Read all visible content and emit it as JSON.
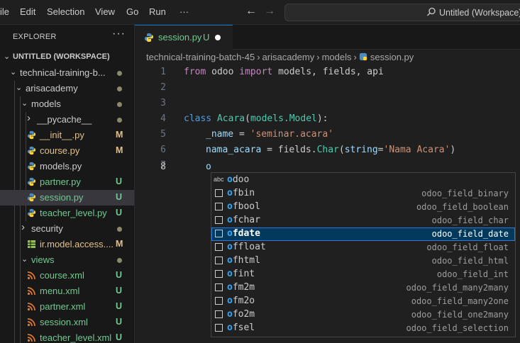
{
  "menu": [
    "ile",
    "Edit",
    "Selection",
    "View",
    "Go",
    "Run",
    "···"
  ],
  "title_bar": {
    "search_text": "Untitled (Workspace)"
  },
  "sidebar": {
    "title": "EXPLORER",
    "more": "···",
    "workspace": "UNTITLED (WORKSPACE)",
    "items": [
      {
        "label": "technical-training-b...",
        "color": "#cccccc",
        "status": "dot"
      },
      {
        "label": "arisacademy",
        "color": "#cccccc",
        "status": "dot"
      },
      {
        "label": "models",
        "color": "#cccccc",
        "status": "dot"
      },
      {
        "label": "__pycache__",
        "color": "#cccccc",
        "status": "dot"
      },
      {
        "label": "__init__.py",
        "color": "#e2c08d",
        "status": "M"
      },
      {
        "label": "course.py",
        "color": "#e2c08d",
        "status": "M"
      },
      {
        "label": "models.py",
        "color": "#cccccc",
        "status": ""
      },
      {
        "label": "partner.py",
        "color": "#73c991",
        "status": "U"
      },
      {
        "label": "session.py",
        "color": "#73c991",
        "status": "U"
      },
      {
        "label": "teacher_level.py",
        "color": "#73c991",
        "status": "U"
      },
      {
        "label": "security",
        "color": "#cccccc",
        "status": "dot"
      },
      {
        "label": "ir.model.access....",
        "color": "#e2c08d",
        "status": "M"
      },
      {
        "label": "views",
        "color": "#73c991",
        "status": "dot"
      },
      {
        "label": "course.xml",
        "color": "#73c991",
        "status": "U"
      },
      {
        "label": "menu.xml",
        "color": "#73c991",
        "status": "U"
      },
      {
        "label": "partner.xml",
        "color": "#73c991",
        "status": "U"
      },
      {
        "label": "session.xml",
        "color": "#73c991",
        "status": "U"
      },
      {
        "label": "teacher_level.xml",
        "color": "#73c991",
        "status": "U"
      }
    ]
  },
  "tab": {
    "name": "session.py",
    "status": "U"
  },
  "breadcrumb": [
    "technical-training-batch-45",
    "arisacademy",
    "models",
    "session.py"
  ],
  "code": {
    "line_numbers": [
      "1",
      "2",
      "3",
      "4",
      "5",
      "6",
      "7",
      "8"
    ],
    "l1": {
      "from": "from",
      "mod": " odoo ",
      "import": "import",
      "rest": " models, fields, api"
    },
    "l4": {
      "class": "class",
      "name": "Acara",
      "base": "models.Model",
      "colon": "):"
    },
    "l5": {
      "var": "_name",
      "eq": " = ",
      "val": "'seminar.acara'"
    },
    "l7": {
      "var": "nama_acara",
      "eq": " = fields.",
      "fn": "Char",
      "open": "(",
      "kw": "string",
      "eq2": "=",
      "val": "'Nama Acara'",
      "close": ")"
    },
    "l8": {
      "typed": "o"
    }
  },
  "suggestions": [
    {
      "kind": "abc",
      "match": "o",
      "rest": "doo",
      "detail": ""
    },
    {
      "kind": "snippet",
      "match": "o",
      "rest": "fbin",
      "detail": "odoo_field_binary"
    },
    {
      "kind": "snippet",
      "match": "o",
      "rest": "fbool",
      "detail": "odoo_field_boolean"
    },
    {
      "kind": "snippet",
      "match": "o",
      "rest": "fchar",
      "detail": "odoo_field_char"
    },
    {
      "kind": "snippet",
      "match": "o",
      "rest": "fdate",
      "detail": "odoo_field_date"
    },
    {
      "kind": "snippet",
      "match": "o",
      "rest": "ffloat",
      "detail": "odoo_field_float"
    },
    {
      "kind": "snippet",
      "match": "o",
      "rest": "fhtml",
      "detail": "odoo_field_html"
    },
    {
      "kind": "snippet",
      "match": "o",
      "rest": "fint",
      "detail": "odoo_field_int"
    },
    {
      "kind": "snippet",
      "match": "o",
      "rest": "fm2m",
      "detail": "odoo_field_many2many"
    },
    {
      "kind": "snippet",
      "match": "o",
      "rest": "fm2o",
      "detail": "odoo_field_many2one"
    },
    {
      "kind": "snippet",
      "match": "o",
      "rest": "fo2m",
      "detail": "odoo_field_one2many"
    },
    {
      "kind": "snippet",
      "match": "o",
      "rest": "fsel",
      "detail": "odoo_field_selection"
    }
  ],
  "focused_suggestion": "ofdate",
  "colors": {
    "accent": "#0078d4",
    "untracked": "#73c991",
    "modified": "#e2c08d",
    "focus_bg": "#04395e"
  }
}
